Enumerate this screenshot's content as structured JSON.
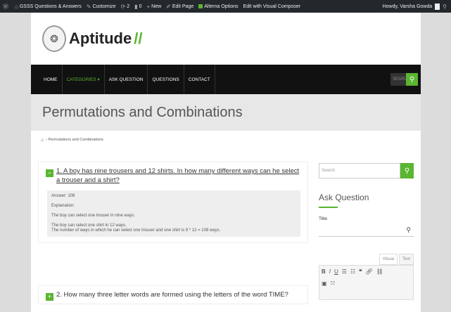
{
  "adminbar": {
    "site_name": "GSSS Questions & Answers",
    "customize": "Customize",
    "updates": "2",
    "comments": "0",
    "new": "New",
    "edit_page": "Edit Page",
    "alterna_options": "Alterna Options",
    "visual_composer": "Edit with Visual Composer",
    "greeting": "Howdy, Varsha Gowda"
  },
  "header": {
    "logo_text": "Aptitude",
    "logo_slash": "//"
  },
  "nav": {
    "items": [
      "Home",
      "Categories",
      "Ask Question",
      "Questions",
      "Contact"
    ],
    "categories_arrow": "▾",
    "search_placeholder": "Search"
  },
  "title": "Permutations and Combinations",
  "breadcrumb": "Permutations and Combinations",
  "questions": [
    {
      "toggle": "−",
      "title": "1. A boy has nine trousers and 12 shirts. In how many different ways can he select a trouser and a shirt?",
      "answer": "Answer: 108",
      "explanation_label": "Explanation:",
      "lines": [
        "The boy can select one trouser in nine ways.",
        "The boy can select one shirt in 12 ways.",
        "The number of ways in which he can select one trouser and one shirt is 9 * 12 = 108 ways."
      ]
    },
    {
      "toggle": "+",
      "title": "2. How many three letter words are formed using the letters of the word TIME?"
    }
  ],
  "sidebar": {
    "search_placeholder": "Search",
    "ask_heading": "Ask Question",
    "title_label": "Title",
    "tab_visual": "Visual",
    "tab_text": "Text"
  },
  "colors": {
    "accent": "#5ab531",
    "adminbar": "#23282d",
    "navbar": "#111111",
    "titlebar": "#e7e7e7"
  }
}
